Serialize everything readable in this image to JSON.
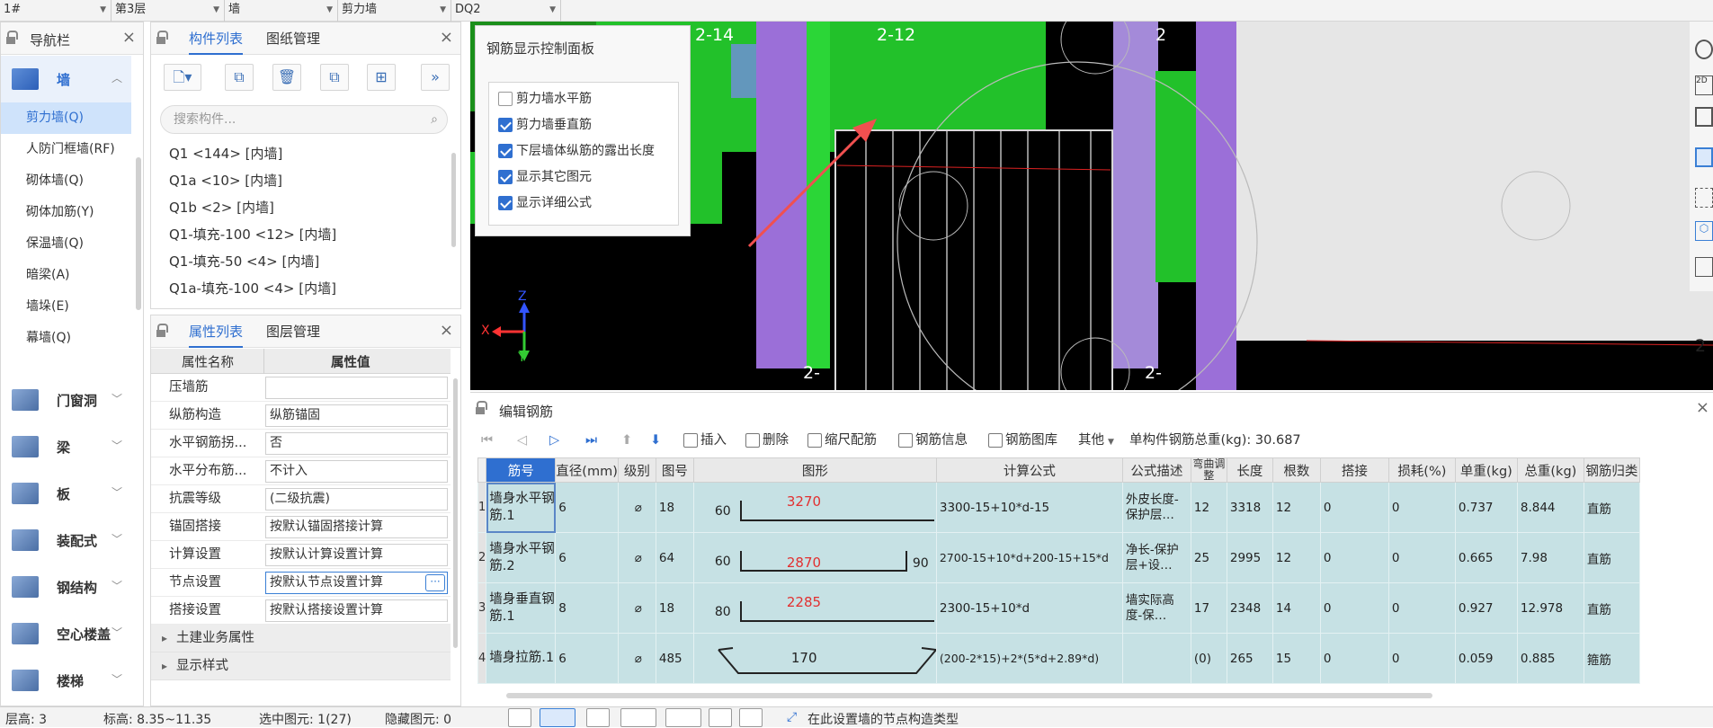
{
  "topbar": {
    "selectors": [
      "1#",
      "第3层",
      "墙",
      "剪力墙",
      "DQ2"
    ]
  },
  "nav": {
    "title": "导航栏",
    "categories": [
      {
        "label": "墙",
        "expanded": true
      },
      {
        "label": "门窗洞"
      },
      {
        "label": "梁"
      },
      {
        "label": "板"
      },
      {
        "label": "装配式"
      },
      {
        "label": "钢结构"
      },
      {
        "label": "空心楼盖"
      },
      {
        "label": "楼梯"
      }
    ],
    "sub_items": [
      "剪力墙(Q)",
      "人防门框墙(RF)",
      "砌体墙(Q)",
      "砌体加筋(Y)",
      "保温墙(Q)",
      "暗梁(A)",
      "墙垛(E)",
      "幕墙(Q)"
    ],
    "selected_sub": "剪力墙(Q)"
  },
  "components": {
    "tabs": [
      "构件列表",
      "图纸管理"
    ],
    "search_placeholder": "搜索构件...",
    "items": [
      "Q1 <144> [内墙]",
      "Q1a <10> [内墙]",
      "Q1b <2> [内墙]",
      "Q1-填充-100 <12> [内墙]",
      "Q1-填充-50 <4> [内墙]",
      "Q1a-填充-100 <4> [内墙]"
    ]
  },
  "properties": {
    "tabs": [
      "属性列表",
      "图层管理"
    ],
    "col_name": "属性名称",
    "col_value": "属性值",
    "rows": [
      {
        "name": "压墙筋",
        "value": ""
      },
      {
        "name": "纵筋构造",
        "value": "纵筋锚固"
      },
      {
        "name": "水平钢筋拐...",
        "value": "否"
      },
      {
        "name": "水平分布筋...",
        "value": "不计入"
      },
      {
        "name": "抗震等级",
        "value": "(二级抗震)"
      },
      {
        "name": "锚固搭接",
        "value": "按默认锚固搭接计算"
      },
      {
        "name": "计算设置",
        "value": "按默认计算设置计算"
      },
      {
        "name": "节点设置",
        "value": "按默认节点设置计算"
      },
      {
        "name": "搭接设置",
        "value": "按默认搭接设置计算"
      }
    ],
    "dots": "···",
    "groups": [
      "土建业务属性",
      "显示样式"
    ]
  },
  "viewport": {
    "grid_labels": [
      "2-14",
      "2-12",
      "2",
      "2-",
      "2-",
      "2"
    ],
    "axis_labels": {
      "x": "X",
      "y": "Y",
      "z": "Z"
    }
  },
  "control_panel": {
    "title": "钢筋显示控制面板",
    "options": [
      {
        "label": "剪力墙水平筋",
        "checked": false
      },
      {
        "label": "剪力墙垂直筋",
        "checked": true
      },
      {
        "label": "下层墙体纵筋的露出长度",
        "checked": true
      },
      {
        "label": "显示其它图元",
        "checked": true
      },
      {
        "label": "显示详细公式",
        "checked": true
      }
    ]
  },
  "edit_rebar": {
    "title": "编辑钢筋",
    "toolbar": {
      "insert": "插入",
      "delete": "删除",
      "scale": "缩尺配筋",
      "info": "钢筋信息",
      "library": "钢筋图库",
      "other": "其他",
      "total_label": "单构件钢筋总重(kg): 30.687"
    },
    "columns": [
      "筋号",
      "直径(mm)",
      "级别",
      "图号",
      "图形",
      "计算公式",
      "公式描述",
      "弯曲调整",
      "长度",
      "根数",
      "搭接",
      "损耗(%)",
      "单重(kg)",
      "总重(kg)",
      "钢筋归类"
    ],
    "grade_symbol": "⌀",
    "rows": [
      {
        "idx": "1",
        "name": "墙身水平钢筋.1",
        "dia": "6",
        "fig": "18",
        "shape_left": "60",
        "shape_mid": "3270",
        "shape_right": "",
        "formula": "3300-15+10*d-15",
        "desc": "外皮长度-保护层…",
        "bend": "12",
        "length": "3318",
        "count": "12",
        "lap": "0",
        "loss": "0",
        "unit": "0.737",
        "total": "8.844",
        "cat": "直筋"
      },
      {
        "idx": "2",
        "name": "墙身水平钢筋.2",
        "dia": "6",
        "fig": "64",
        "shape_left": "60",
        "shape_mid": "2870",
        "shape_right": "90",
        "formula": "2700-15+10*d+200-15+15*d",
        "desc": "净长-保护层+设…",
        "bend": "25",
        "length": "2995",
        "count": "12",
        "lap": "0",
        "loss": "0",
        "unit": "0.665",
        "total": "7.98",
        "cat": "直筋"
      },
      {
        "idx": "3",
        "name": "墙身垂直钢筋.1",
        "dia": "8",
        "fig": "18",
        "shape_left": "80",
        "shape_mid": "2285",
        "shape_right": "",
        "formula": "2300-15+10*d",
        "desc": "墙实际高度-保…",
        "bend": "17",
        "length": "2348",
        "count": "14",
        "lap": "0",
        "loss": "0",
        "unit": "0.927",
        "total": "12.978",
        "cat": "直筋"
      },
      {
        "idx": "4",
        "name": "墙身拉筋.1",
        "dia": "6",
        "fig": "485",
        "shape_left": "",
        "shape_mid": "170",
        "shape_right": "",
        "formula": "(200-2*15)+2*(5*d+2.89*d)",
        "desc": "",
        "bend": "(0)",
        "length": "265",
        "count": "15",
        "lap": "0",
        "loss": "0",
        "unit": "0.059",
        "total": "0.885",
        "cat": "箍筋"
      }
    ]
  },
  "status": {
    "floor": "层高:  3",
    "elev": "标高:  8.35~11.35",
    "selected": "选中图元: 1(27)",
    "hidden": "隐藏图元: 0",
    "hint": "在此设置墙的节点构造类型"
  },
  "colors": {
    "accent": "#2f6fd0",
    "grid_row": "#c6e1e4",
    "green": "#22c12a",
    "purple": "#9b6fd8"
  }
}
